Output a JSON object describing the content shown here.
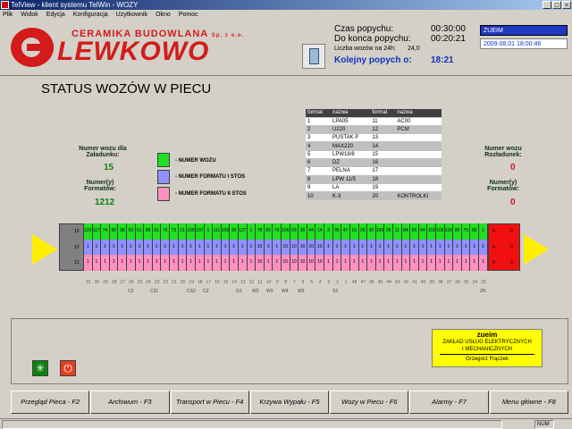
{
  "window": {
    "title": "TelView - klient systemu TelWin - WOZY"
  },
  "menu": [
    "Plik",
    "Widok",
    "Edycja",
    "Konfiguracja",
    "Uzytkownik",
    "Okno",
    "Pomoc"
  ],
  "logo": {
    "line1": "CERAMIKA BUDOWLANA",
    "line1_suffix": "Sp. z o.o.",
    "line2": "LEWKOWO"
  },
  "header": {
    "czas_label": "Czas popychu:",
    "czas_value": "00:30:00",
    "do_konca_label": "Do konca popychu:",
    "do_konca_value": "00:20:21",
    "liczba_label": "Liczba wozów na 24h:",
    "liczba_value": "24,0",
    "kolejny_label": "Kolejny popych o:",
    "kolejny_value": "18:21",
    "user": "ZUEIM",
    "datetime": "2009.08.01 18:00:46"
  },
  "page_title": "STATUS WOZÓW W PIECU",
  "formats": {
    "headers": [
      "format",
      "nazwa",
      "format",
      "nazwa"
    ],
    "rows": [
      [
        "1",
        "LPA05",
        "11",
        "AC00"
      ],
      [
        "2",
        "U220",
        "12",
        "PCM"
      ],
      [
        "3",
        "PUSTAK P",
        "13",
        ""
      ],
      [
        "4",
        "MAX220",
        "14",
        ""
      ],
      [
        "5",
        "LPW18/8",
        "15",
        ""
      ],
      [
        "6",
        "DZ",
        "16",
        ""
      ],
      [
        "7",
        "PELNA",
        "17",
        ""
      ],
      [
        "8",
        "LPW 11/5",
        "18",
        ""
      ],
      [
        "9",
        "LA",
        "19",
        ""
      ],
      [
        "10",
        "K-3",
        "20",
        "KONTROLKI"
      ]
    ]
  },
  "left_info": {
    "numer_wozu_label": "Numer wozu dla Załadunku:",
    "numer_wozu_value": "15",
    "numery_label": "Numer(y) Formatów:",
    "numery_value": "1212"
  },
  "right_info": {
    "numer_wozu_label": "Numer wozu Rozładunek:",
    "numer_wozu_value": "0",
    "numery_label": "Numer(y) Formatów:",
    "numery_value": "0"
  },
  "legend": [
    {
      "color": "#20e020",
      "label": "- NUMER WOZU"
    },
    {
      "color": "#9090ff",
      "label": "- NUMER FORMATU I STOS"
    },
    {
      "color": "#ff90c0",
      "label": "- NUMER FORMATU II STOS"
    }
  ],
  "kiln_start": {
    "labels": [
      "15",
      "12",
      "12"
    ]
  },
  "kiln_end": {
    "labels": [
      "0",
      "0",
      "0",
      "0",
      "0",
      "0"
    ]
  },
  "cars": [
    [
      "129",
      "1",
      "1"
    ],
    [
      "117",
      "1",
      "1"
    ],
    [
      "74",
      "1",
      "1"
    ],
    [
      "96",
      "1",
      "1"
    ],
    [
      "98",
      "1",
      "1"
    ],
    [
      "53",
      "1",
      "1"
    ],
    [
      "51",
      "1",
      "1"
    ],
    [
      "88",
      "1",
      "1"
    ],
    [
      "61",
      "1",
      "1"
    ],
    [
      "76",
      "1",
      "1"
    ],
    [
      "73",
      "1",
      "1"
    ],
    [
      "21",
      "1",
      "1"
    ],
    [
      "105",
      "1",
      "1"
    ],
    [
      "107",
      "1",
      "1"
    ],
    [
      "1",
      "1",
      "1"
    ],
    [
      "111",
      "1",
      "1"
    ],
    [
      "109",
      "1",
      "1"
    ],
    [
      "90",
      "1",
      "1"
    ],
    [
      "127",
      "1",
      "1"
    ],
    [
      "1",
      "1",
      "1"
    ],
    [
      "78",
      "10",
      "10"
    ],
    [
      "81",
      "1",
      "1"
    ],
    [
      "79",
      "1",
      "1"
    ],
    [
      "106",
      "10",
      "10"
    ],
    [
      "63",
      "10",
      "10"
    ],
    [
      "30",
      "10",
      "10"
    ],
    [
      "44",
      "10",
      "10"
    ],
    [
      "14",
      "10",
      "10"
    ],
    [
      "3",
      "1",
      "1"
    ],
    [
      "95",
      "1",
      "1"
    ],
    [
      "47",
      "1",
      "1"
    ],
    [
      "16",
      "1",
      "1"
    ],
    [
      "28",
      "1",
      "1"
    ],
    [
      "35",
      "1",
      "1"
    ],
    [
      "100",
      "1",
      "1"
    ],
    [
      "26",
      "1",
      "1"
    ],
    [
      "11",
      "1",
      "1"
    ],
    [
      "84",
      "1",
      "1"
    ],
    [
      "55",
      "1",
      "1"
    ],
    [
      "64",
      "1",
      "1"
    ],
    [
      "118",
      "1",
      "1"
    ],
    [
      "108",
      "1",
      "1"
    ],
    [
      "116",
      "1",
      "1"
    ],
    [
      "99",
      "1",
      "1"
    ],
    [
      "75",
      "1",
      "1"
    ],
    [
      "86",
      "1",
      "1"
    ],
    [
      "1",
      "1",
      "1"
    ]
  ],
  "positions": [
    "31",
    "30",
    "29",
    "28",
    "27",
    "26",
    "25",
    "24",
    "23",
    "22",
    "21",
    "20",
    "19",
    "18",
    "17",
    "16",
    "15",
    "14",
    "13",
    "12",
    "11",
    "10",
    "9",
    "8",
    "7",
    "6",
    "5",
    "4",
    "3",
    "2",
    "1",
    "48",
    "47",
    "46",
    "45",
    "44",
    "43",
    "42",
    "41",
    "40",
    "39",
    "38",
    "37",
    "36",
    "35",
    "34",
    "33"
  ],
  "markers": [
    "C3",
    "C31",
    "CS2",
    "CZ",
    "G1",
    "W2",
    "W3",
    "W4",
    "W5",
    "S3",
    "ZN"
  ],
  "company": {
    "name": "zueim",
    "line1": "ZAKŁAD USŁUG ELEKTRYCZNYCH",
    "line2": "I MECHANICZNYCH",
    "person": "Grzegorz Frączek"
  },
  "fkeys": [
    "Przegląd Pieca - F2",
    "Archiwum - F3",
    "Transport w Piecu - F4",
    "Krzywa Wypału - F5",
    "Wozy w Piecu - F6",
    "Alarmy - F7",
    "Menu główne - F8"
  ],
  "status": {
    "num": "NUM"
  }
}
